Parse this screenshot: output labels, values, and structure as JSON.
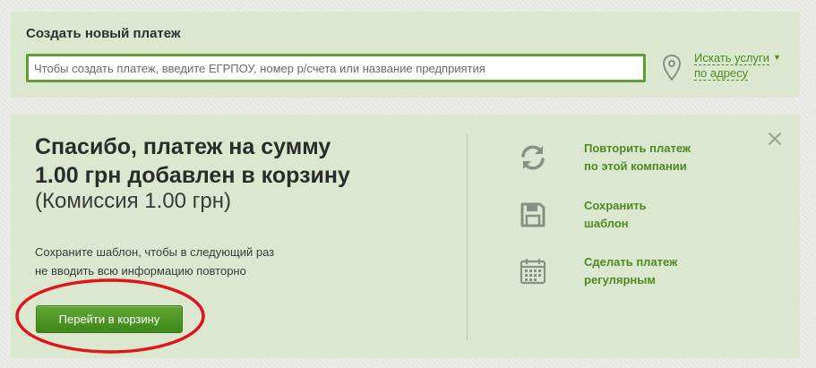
{
  "create_payment": {
    "title": "Создать новый платеж",
    "search_placeholder": "Чтобы создать платеж, введите ЕГРПОУ, номер р/счета или название предприятия",
    "search_value": "",
    "address_link_line1": "Искать услуги",
    "address_link_line2": "по адресу",
    "icons": {
      "location": "location-pin-icon",
      "caret": "caret-down-icon"
    }
  },
  "confirmation": {
    "headline_line1": "Спасибо,  платеж на сумму",
    "headline_line2": "1.00 грн  добавлен в корзину",
    "commission": "(Комиссия 1.00 грн)",
    "hint_line1": "Сохраните шаблон, чтобы в следующий раз",
    "hint_line2": "не вводить всю информацию повторно",
    "go_to_cart_label": "Перейти в корзину"
  },
  "actions": [
    {
      "line1": "Повторить платеж",
      "line2": "по этой компании",
      "icon": "refresh-icon"
    },
    {
      "line1": "Сохранить",
      "line2": "шаблон",
      "icon": "floppy-disk-icon"
    },
    {
      "line1": "Сделать платеж",
      "line2": "регулярным",
      "icon": "calendar-icon"
    }
  ],
  "colors": {
    "card_bg": "#dbe8cf",
    "accent_green": "#4d8a1f",
    "input_border": "#5da02f",
    "button_green": "#3e8619",
    "highlight_red": "#e0141b",
    "icon_gray": "#8a8f86"
  }
}
